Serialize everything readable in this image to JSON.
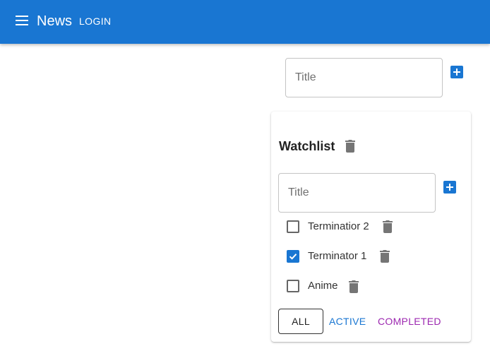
{
  "header": {
    "title": "News",
    "login_label": "LOGIN",
    "menu_icon": "menu-icon"
  },
  "new_list": {
    "title_placeholder": "Title",
    "add_icon": "plus-box-icon"
  },
  "list": {
    "title": "Watchlist",
    "delete_icon": "trash-icon",
    "add_task": {
      "title_placeholder": "Title",
      "add_icon": "plus-box-icon"
    },
    "tasks": [
      {
        "label": "Terminatior 2",
        "checked": false
      },
      {
        "label": "Terminator 1",
        "checked": true
      },
      {
        "label": "Anime",
        "checked": false
      }
    ],
    "filters": {
      "all": "ALL",
      "active": "ACTIVE",
      "completed": "COMPLETED",
      "selected": "all"
    }
  },
  "colors": {
    "primary": "#1976d2",
    "secondary": "#9c27b0",
    "icon_grey": "#757575"
  }
}
